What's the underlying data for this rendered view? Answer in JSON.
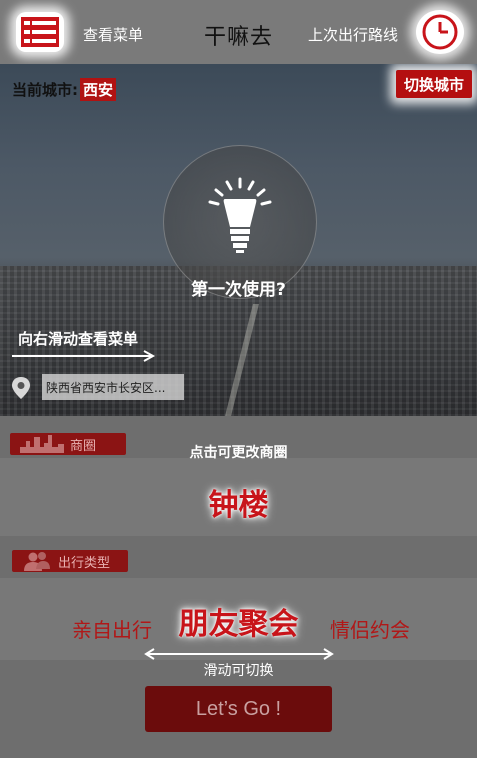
{
  "header": {
    "menu_label": "查看菜单",
    "title": "干嘛去",
    "history_label": "上次出行路线"
  },
  "city": {
    "label": "当前城市:",
    "value": "西安",
    "switch_label": "切换城市"
  },
  "guide": {
    "first_use": "第一次使用?",
    "swipe_menu_hint": "向右滑动查看菜单",
    "tap_hint": "点击可更改商圈",
    "swipe_switch_hint": "滑动可切换"
  },
  "location": {
    "value": "陕西省西安市长安区..."
  },
  "district": {
    "tag": "商圈",
    "value": "钟楼"
  },
  "travel_type": {
    "tag": "出行类型",
    "options": [
      "亲自出行",
      "朋友聚会",
      "情侣约会"
    ],
    "selected": "朋友聚会"
  },
  "action": {
    "go_label": "Let’s Go !"
  },
  "colors": {
    "accent": "#c8141a",
    "tag_bg": "#8b1414",
    "button_bg": "#6b0c0c"
  }
}
